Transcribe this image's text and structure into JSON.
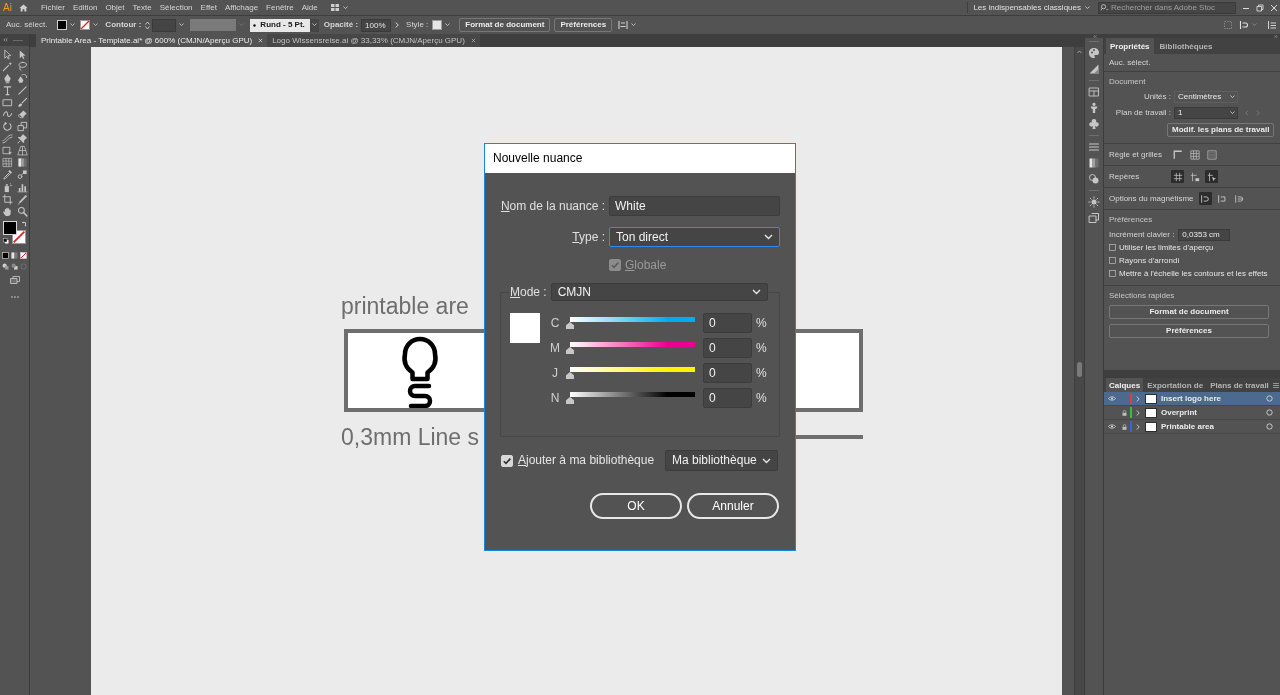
{
  "menu_bar": {
    "logo": "Ai",
    "items": [
      "Fichier",
      "Edition",
      "Objet",
      "Texte",
      "Sélection",
      "Effet",
      "Affichage",
      "Fenêtre",
      "Aide"
    ],
    "workspace": "Les indispensables classiques",
    "search": {
      "placeholder": "Rechercher dans Adobe Stoc"
    }
  },
  "control_bar": {
    "selection": "Auc. sélect.",
    "stroke_label": "Contour :",
    "brush": "Rund - 5 Pt.",
    "opacity_label": "Opacité :",
    "opacity": "100%",
    "style_label": "Style :",
    "buttons": [
      "Format de document",
      "Préférences"
    ]
  },
  "document_tabs": [
    {
      "title": "Printable Area - Template.ai* @ 600% (CMJN/Aperçu GPU)",
      "selected": true
    },
    {
      "title": "Logo Wissensreise.ai @ 33,33% (CMJN/Aperçu GPU)",
      "selected": false
    }
  ],
  "artboard": {
    "heading": "printable are",
    "caption": "0,3mm Line s"
  },
  "dialog": {
    "title": "Nouvelle nuance",
    "name": {
      "label": "Nom de la nuance :",
      "value": "White"
    },
    "type": {
      "label": "Type :",
      "value": "Ton direct",
      "focused": true
    },
    "global": {
      "label": "Globale",
      "checked": true,
      "disabled": true
    },
    "mode": {
      "label": "Mode :",
      "value": "CMJN"
    },
    "channels": [
      {
        "name": "C",
        "color": "#00aeef",
        "level": 0,
        "value": "0",
        "unit": "%"
      },
      {
        "name": "M",
        "color": "#ec008c",
        "level": 0,
        "value": "0",
        "unit": "%"
      },
      {
        "name": "J",
        "color": "#fff200",
        "level": 0,
        "value": "0",
        "unit": "%"
      },
      {
        "name": "N",
        "color": "#000000",
        "level": 0,
        "value": "0",
        "unit": "%"
      }
    ],
    "add_to_library": {
      "label": "Ajouter à ma bibliothèque",
      "checked": true
    },
    "library": "Ma bibliothèque",
    "buttons": [
      "OK",
      "Annuler"
    ]
  },
  "properties_panel": {
    "tabs": [
      {
        "label": "Propriétés",
        "selected": true
      },
      {
        "label": "Bibliothèques",
        "selected": false
      }
    ],
    "selection": "Auc. sélect.",
    "document": {
      "title": "Document",
      "units_label": "Unités :",
      "units": "Centimètres",
      "artboard_label": "Plan de travail :",
      "artboard": "1",
      "edit_button": "Modif. les plans de travail"
    },
    "rulers": {
      "label": "Règle et grilles"
    },
    "guides": {
      "label": "Repères",
      "buttons": [
        {
          "on": true
        },
        {
          "on": false
        },
        {
          "on": true
        }
      ]
    },
    "snapping": {
      "label": "Options du magnétisme",
      "buttons": [
        {
          "on": true
        },
        {
          "on": false
        },
        {
          "on": false
        }
      ]
    },
    "preferences": {
      "title": "Préférences",
      "increment_label": "Incrément clavier :",
      "increment": "0,0353 cm",
      "options": [
        {
          "label": "Utiliser les limites d'aperçu",
          "checked": false
        },
        {
          "label": "Rayons d'arrondi",
          "checked": false
        },
        {
          "label": "Mettre à l'échelle les contours et les effets",
          "checked": false
        }
      ]
    },
    "quick_actions": {
      "title": "Sélections rapides",
      "buttons": [
        "Format de document",
        "Préférences"
      ]
    }
  },
  "layers_panel": {
    "tabs": [
      {
        "label": "Calques",
        "selected": true
      },
      {
        "label": "Exportation de",
        "selected": false
      },
      {
        "label": "Plans de travail",
        "selected": false
      }
    ],
    "layers": [
      {
        "name": "Insert logo here",
        "visible": true,
        "locked": false,
        "color": "#e8393f",
        "selected": true
      },
      {
        "name": "Overprint",
        "visible": false,
        "locked": true,
        "color": "#34c23a",
        "selected": false
      },
      {
        "name": "Printable area",
        "visible": true,
        "locked": true,
        "color": "#3d5ee8",
        "selected": false
      }
    ]
  }
}
